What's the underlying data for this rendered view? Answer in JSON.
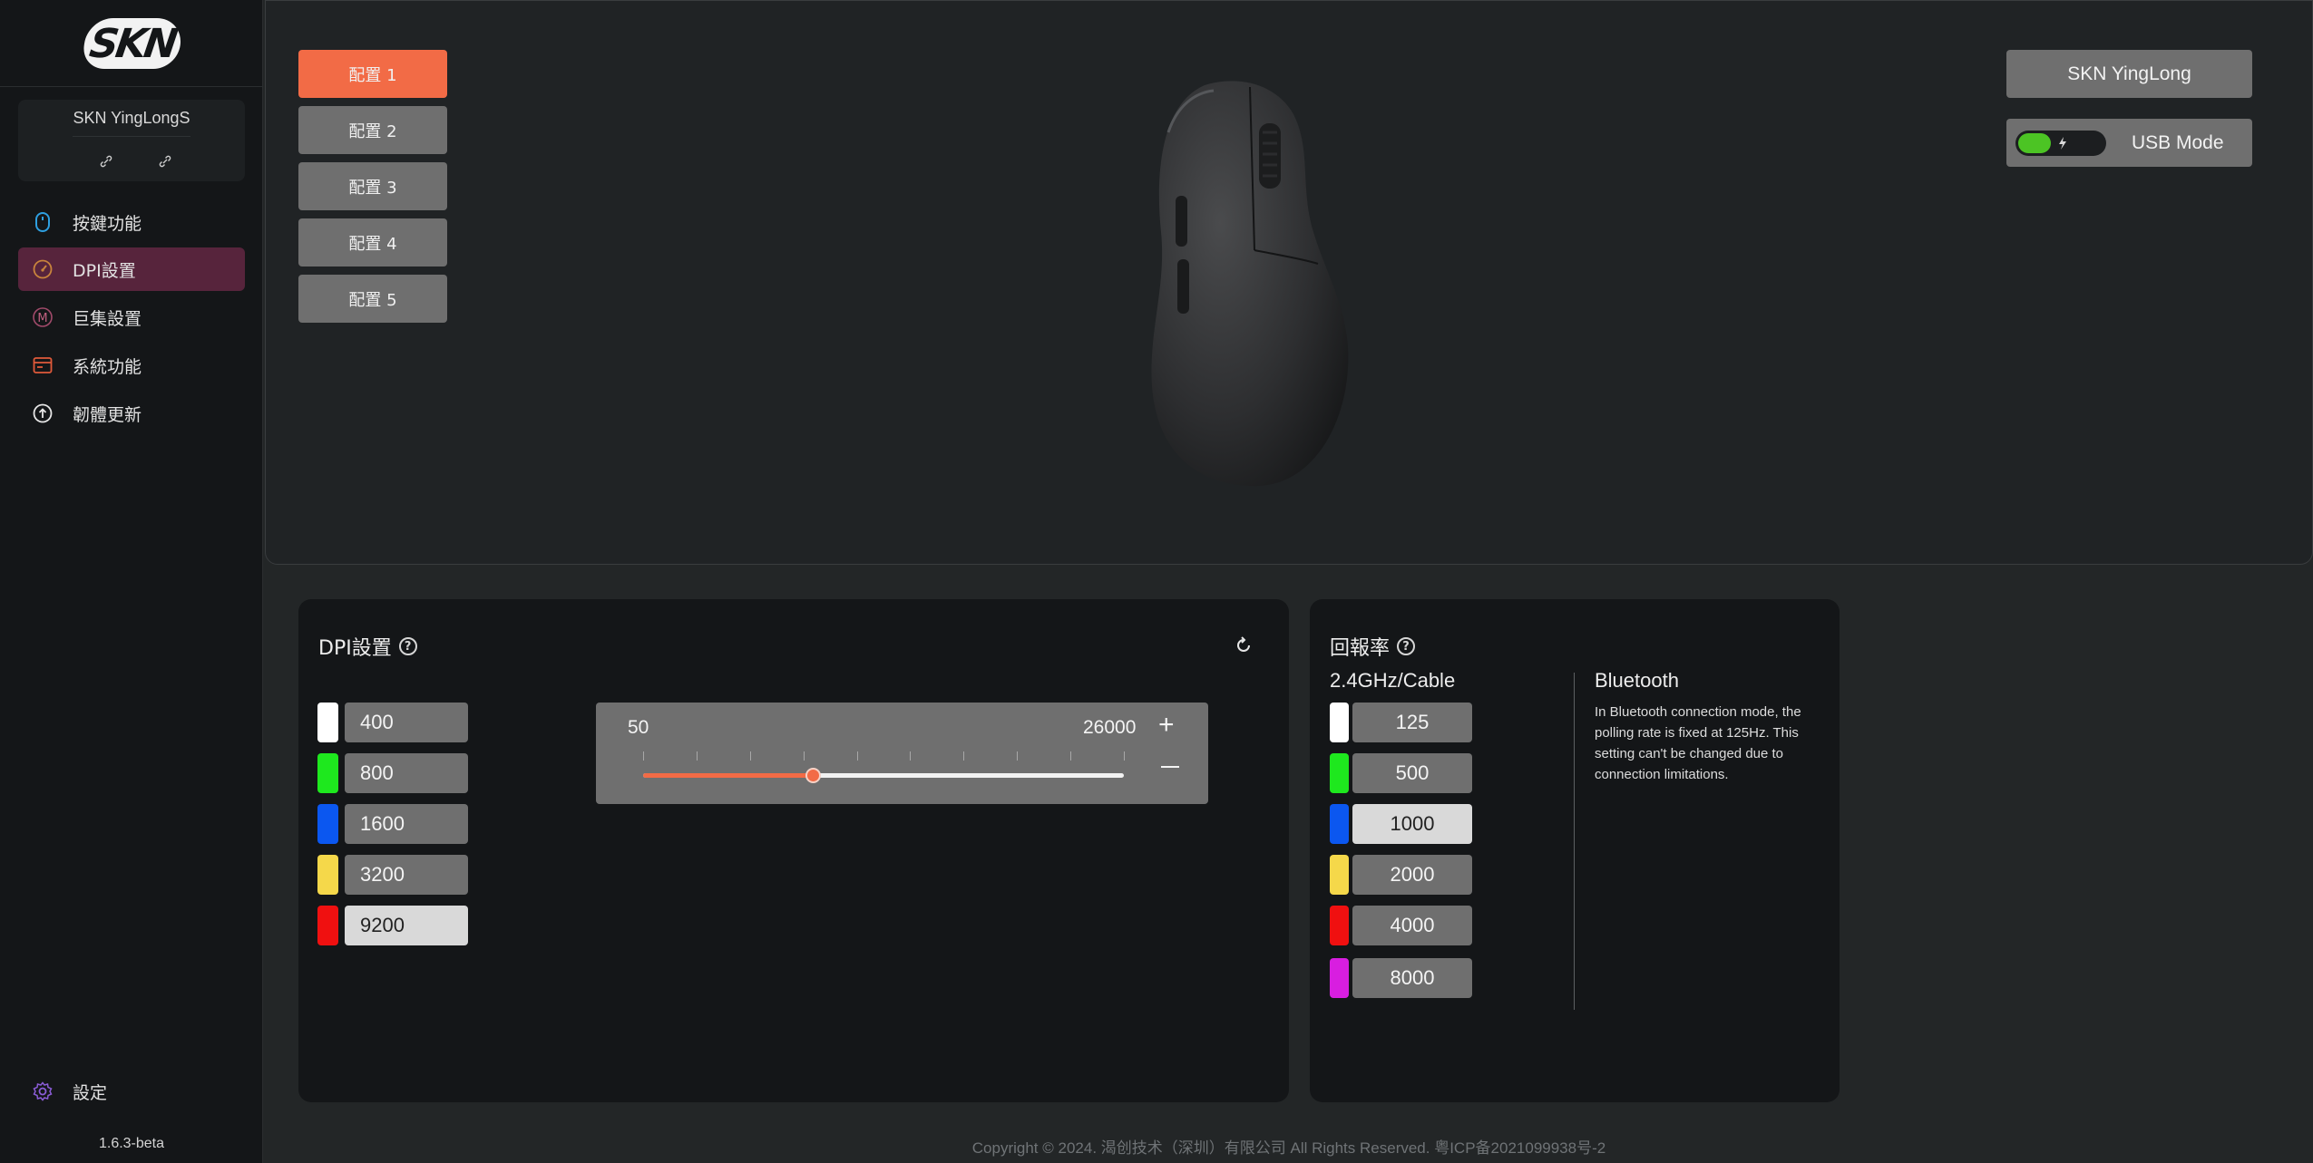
{
  "sidebar": {
    "logo_text": "SKN",
    "device_name": "SKN YingLongS",
    "nav": [
      {
        "label": "按鍵功能",
        "icon": "mouse-icon"
      },
      {
        "label": "DPI設置",
        "icon": "speedometer-icon"
      },
      {
        "label": "巨集設置",
        "icon": "macro-m-icon"
      },
      {
        "label": "系統功能",
        "icon": "system-window-icon"
      },
      {
        "label": "韌體更新",
        "icon": "firmware-upload-icon"
      }
    ],
    "active_nav": "DPI設置",
    "settings_label": "設定",
    "version": "1.6.3-beta"
  },
  "profiles": [
    "配置 1",
    "配置 2",
    "配置 3",
    "配置 4",
    "配置 5"
  ],
  "active_profile": "配置 1",
  "device": {
    "name_button": "SKN YingLong",
    "mode_label": "USB Mode"
  },
  "dpi": {
    "title": "DPI設置",
    "levels": [
      {
        "value": "400",
        "color": "#ffffff"
      },
      {
        "value": "800",
        "color": "#1ee81e"
      },
      {
        "value": "1600",
        "color": "#0b57f0"
      },
      {
        "value": "3200",
        "color": "#f5d84a"
      },
      {
        "value": "9200",
        "color": "#f01010"
      }
    ],
    "selected": "9200",
    "slider": {
      "min": "50",
      "max": "26000",
      "plus": "+",
      "position_fraction": 0.352
    }
  },
  "polling": {
    "title": "回報率",
    "subtitle": "2.4GHz/Cable",
    "rates": [
      {
        "value": "125",
        "color": "#ffffff"
      },
      {
        "value": "500",
        "color": "#1ee81e"
      },
      {
        "value": "1000",
        "color": "#0b57f0"
      },
      {
        "value": "2000",
        "color": "#f5d84a"
      },
      {
        "value": "4000",
        "color": "#f01010"
      },
      {
        "value": "8000",
        "color": "#d81ee0"
      }
    ],
    "selected": "1000",
    "bluetooth_title": "Bluetooth",
    "bluetooth_desc": "In Bluetooth connection mode, the polling rate is fixed at 125Hz. This setting can't be changed due to connection limitations."
  },
  "footer": "Copyright © 2024. 渴创技术（深圳）有限公司 All Rights Reserved. 粤ICP备2021099938号-2",
  "colors": {
    "accent": "#f26b46",
    "active_nav_bg": "#57243c",
    "toggle_on": "#4cc424"
  }
}
